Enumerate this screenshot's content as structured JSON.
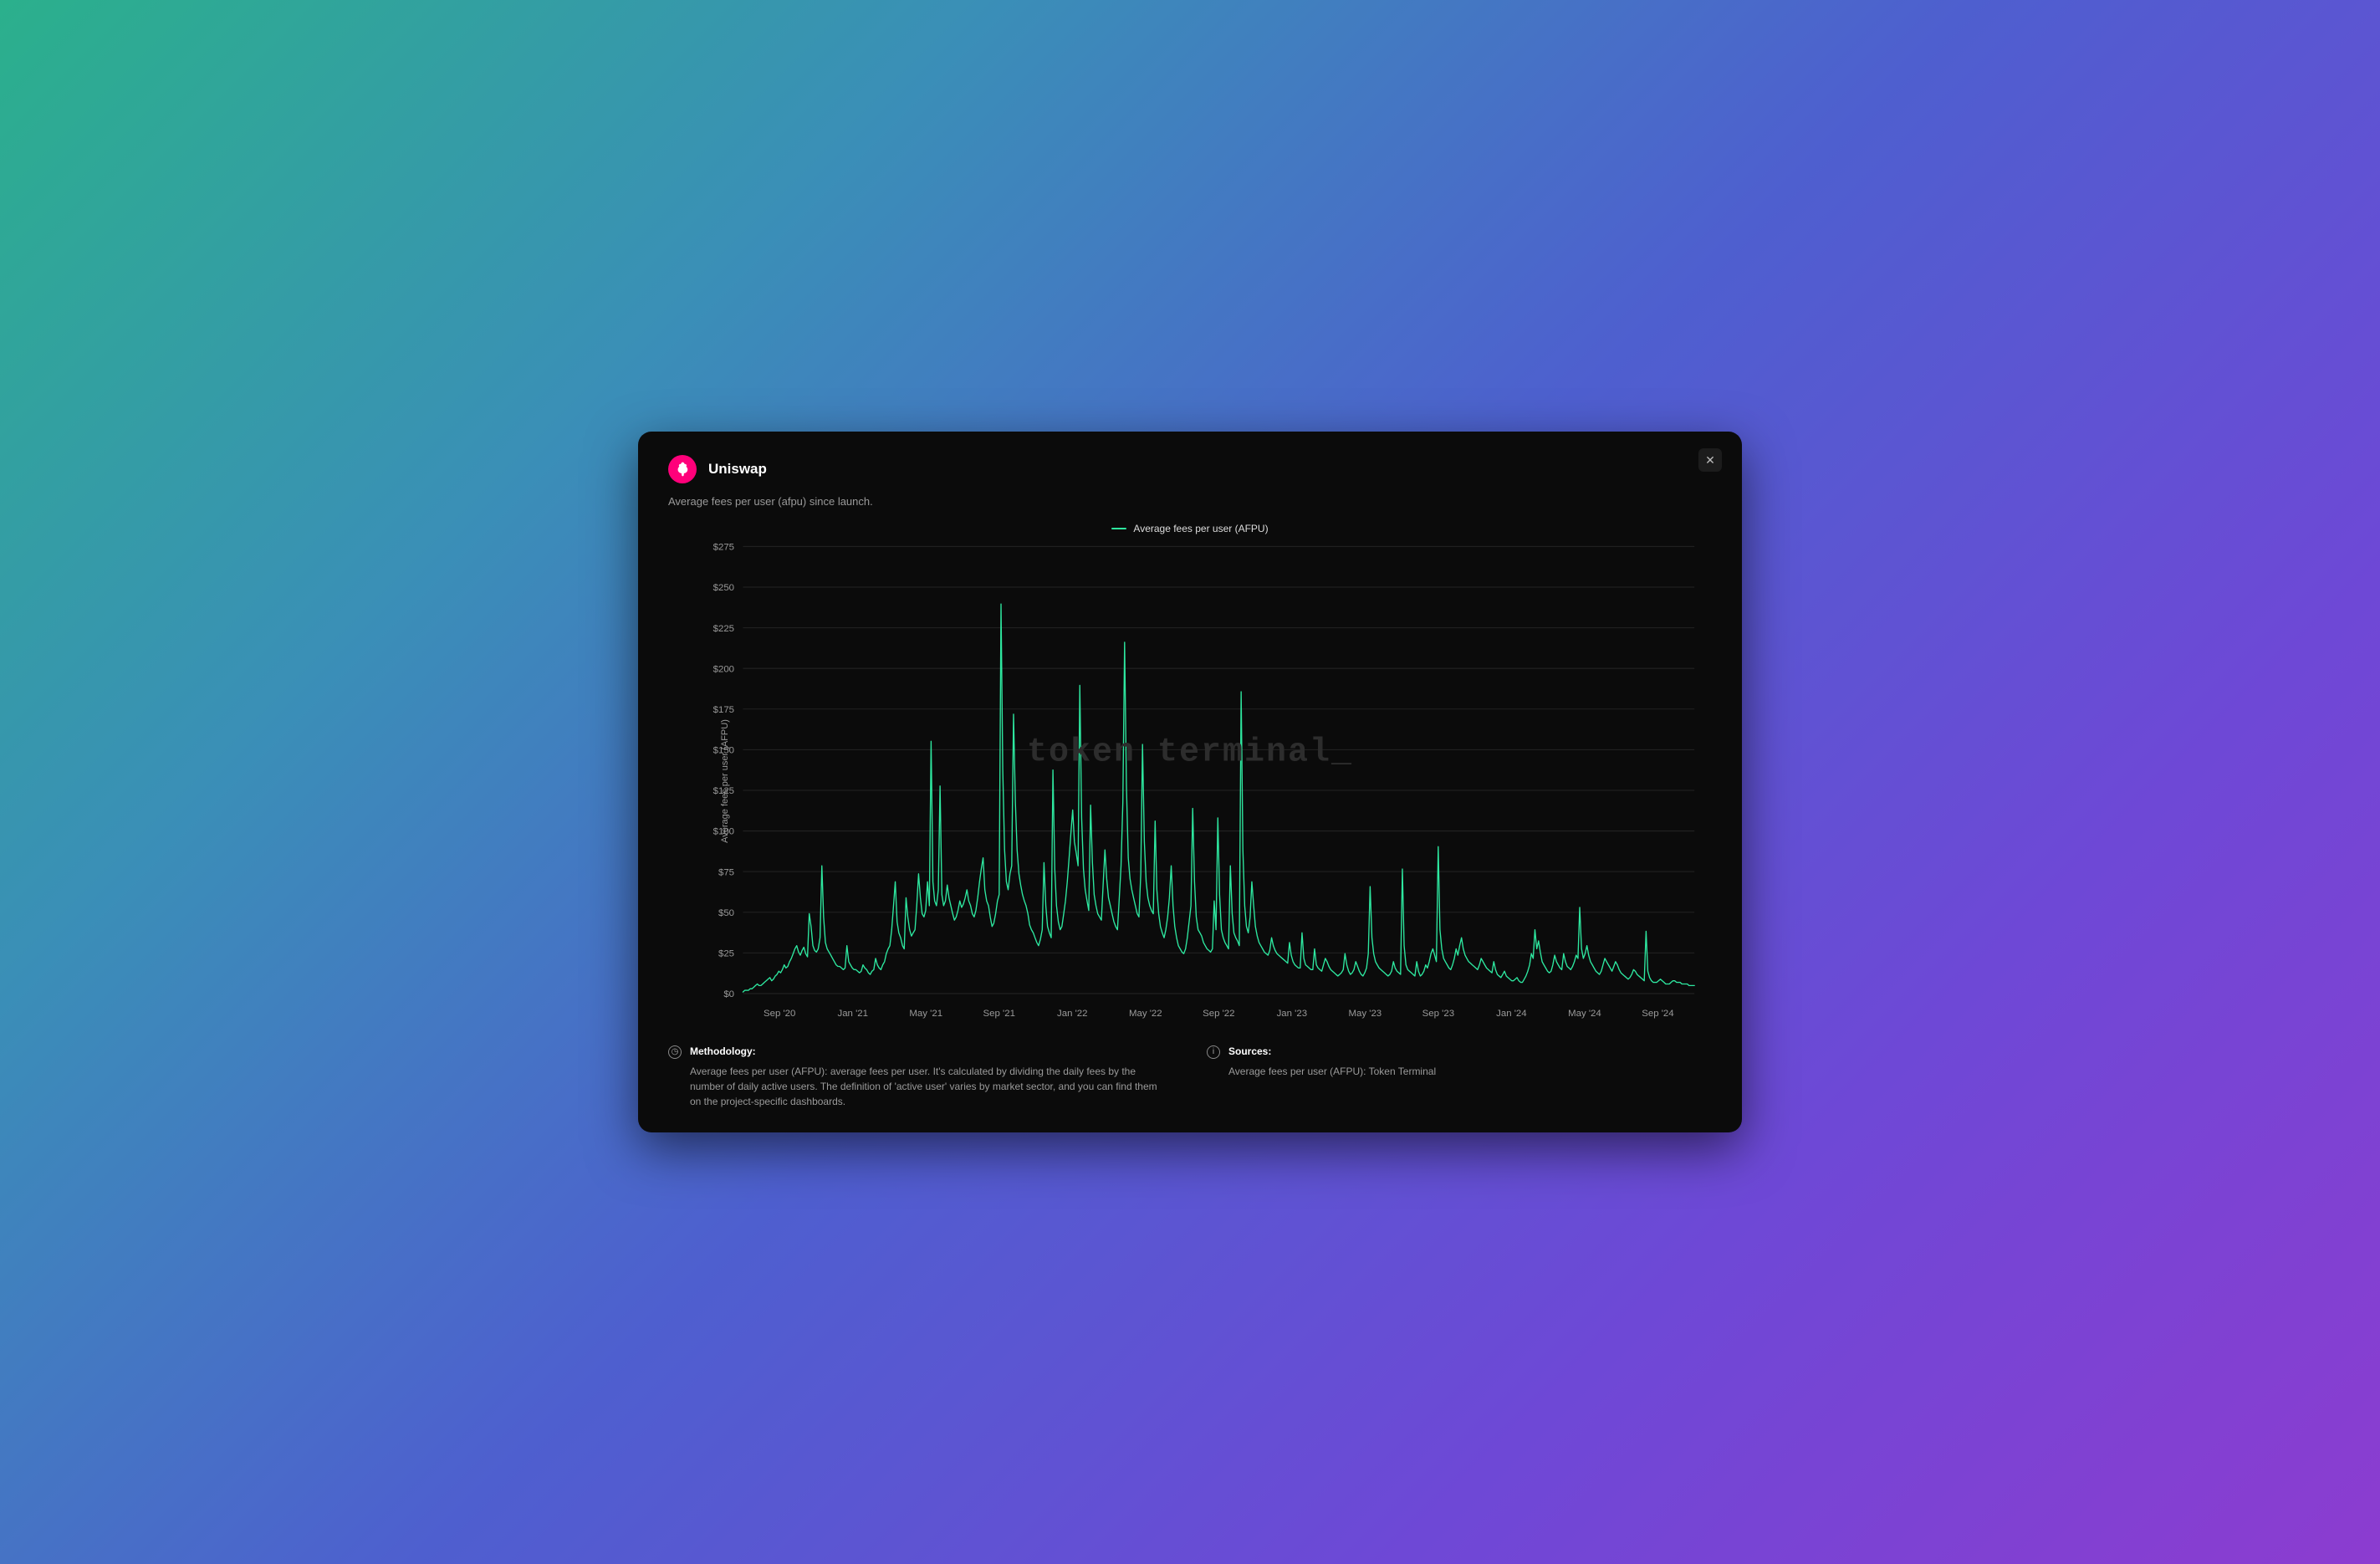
{
  "header": {
    "title": "Uniswap",
    "subtitle": "Average fees per user (afpu) since launch.",
    "logo_label": "Uniswap"
  },
  "close_label": "✕",
  "legend": {
    "series_name": "Average fees per user (AFPU)"
  },
  "y_axis_label": "Average fees per user (AFPU)",
  "watermark": "token terminal_",
  "footer": {
    "methodology_title": "Methodology:",
    "methodology_text": "Average fees per user (AFPU): average fees per user. It's calculated by dividing the daily fees by the number of daily active users. The definition of 'active user' varies by market sector, and you can find them on the project-specific dashboards.",
    "sources_title": "Sources:",
    "sources_text": "Average fees per user (AFPU): Token Terminal"
  },
  "colors": {
    "line": "#2ee8a0",
    "panel": "#0b0b0b",
    "grid": "#232323",
    "tick": "#9a9a9a"
  },
  "chart_data": {
    "type": "line",
    "title": "Average fees per user (afpu) since launch.",
    "xlabel": "",
    "ylabel": "Average fees per user (AFPU)",
    "ylim": [
      0,
      280
    ],
    "y_ticks": [
      "$0",
      "$25",
      "$50",
      "$75",
      "$100",
      "$125",
      "$150",
      "$175",
      "$200",
      "$225",
      "$250",
      "$275"
    ],
    "x_ticks": [
      "Sep '20",
      "Jan '21",
      "May '21",
      "Sep '21",
      "Jan '22",
      "May '22",
      "Sep '22",
      "Jan '23",
      "May '23",
      "Sep '23",
      "Jan '24",
      "May '24",
      "Sep '24"
    ],
    "series": [
      {
        "name": "Average fees per user (AFPU)",
        "values": [
          1,
          2,
          2,
          2,
          3,
          3,
          4,
          5,
          6,
          5,
          5,
          6,
          7,
          8,
          9,
          10,
          8,
          9,
          11,
          12,
          14,
          13,
          15,
          18,
          16,
          17,
          20,
          22,
          25,
          28,
          30,
          26,
          24,
          27,
          29,
          25,
          23,
          50,
          42,
          30,
          27,
          26,
          28,
          35,
          80,
          48,
          32,
          28,
          26,
          24,
          22,
          20,
          18,
          17,
          17,
          16,
          15,
          16,
          30,
          20,
          18,
          16,
          15,
          15,
          14,
          13,
          14,
          18,
          16,
          15,
          13,
          12,
          14,
          15,
          22,
          18,
          16,
          15,
          18,
          20,
          25,
          28,
          30,
          40,
          55,
          70,
          45,
          38,
          35,
          30,
          28,
          60,
          48,
          40,
          36,
          38,
          40,
          55,
          75,
          60,
          50,
          48,
          52,
          70,
          55,
          158,
          70,
          58,
          55,
          65,
          130,
          62,
          55,
          58,
          68,
          60,
          55,
          50,
          46,
          48,
          52,
          58,
          54,
          56,
          60,
          65,
          58,
          55,
          50,
          48,
          52,
          60,
          70,
          78,
          85,
          65,
          58,
          55,
          48,
          42,
          44,
          50,
          58,
          62,
          244,
          140,
          90,
          70,
          65,
          75,
          80,
          175,
          120,
          90,
          75,
          68,
          62,
          58,
          55,
          50,
          43,
          40,
          38,
          35,
          32,
          30,
          34,
          40,
          82,
          55,
          42,
          38,
          35,
          140,
          78,
          55,
          45,
          40,
          42,
          50,
          58,
          70,
          85,
          100,
          115,
          95,
          88,
          80,
          193,
          110,
          78,
          65,
          58,
          52,
          118,
          82,
          62,
          55,
          50,
          48,
          46,
          68,
          90,
          72,
          60,
          55,
          50,
          45,
          42,
          40,
          60,
          80,
          120,
          220,
          130,
          85,
          72,
          65,
          60,
          55,
          50,
          48,
          75,
          156,
          95,
          70,
          60,
          55,
          52,
          50,
          108,
          65,
          50,
          42,
          38,
          35,
          40,
          48,
          60,
          80,
          55,
          42,
          35,
          30,
          28,
          26,
          25,
          28,
          35,
          45,
          55,
          116,
          70,
          48,
          40,
          38,
          36,
          32,
          30,
          28,
          27,
          26,
          28,
          58,
          40,
          110,
          62,
          40,
          35,
          32,
          30,
          28,
          80,
          50,
          38,
          35,
          33,
          30,
          189,
          90,
          55,
          42,
          38,
          48,
          70,
          55,
          42,
          36,
          32,
          30,
          28,
          26,
          25,
          24,
          27,
          35,
          30,
          27,
          25,
          24,
          23,
          22,
          21,
          20,
          19,
          32,
          24,
          20,
          18,
          17,
          16,
          16,
          38,
          22,
          18,
          17,
          16,
          15,
          15,
          28,
          18,
          16,
          15,
          14,
          18,
          22,
          20,
          17,
          15,
          14,
          13,
          12,
          11,
          12,
          13,
          15,
          25,
          18,
          14,
          12,
          13,
          15,
          20,
          17,
          14,
          12,
          11,
          13,
          16,
          25,
          67,
          35,
          25,
          20,
          18,
          16,
          15,
          14,
          13,
          12,
          11,
          12,
          14,
          20,
          16,
          14,
          13,
          12,
          78,
          30,
          18,
          15,
          14,
          13,
          12,
          11,
          20,
          14,
          11,
          12,
          14,
          18,
          16,
          20,
          25,
          28,
          24,
          20,
          92,
          40,
          28,
          22,
          20,
          18,
          16,
          15,
          18,
          22,
          28,
          24,
          30,
          35,
          28,
          24,
          22,
          20,
          19,
          18,
          17,
          16,
          15,
          18,
          22,
          20,
          18,
          16,
          15,
          14,
          13,
          20,
          15,
          12,
          11,
          10,
          12,
          14,
          11,
          10,
          9,
          8,
          8,
          9,
          10,
          8,
          7,
          7,
          9,
          11,
          14,
          18,
          25,
          22,
          40,
          28,
          33,
          26,
          20,
          18,
          16,
          14,
          13,
          14,
          18,
          24,
          20,
          18,
          16,
          15,
          25,
          20,
          17,
          16,
          15,
          17,
          20,
          24,
          22,
          54,
          28,
          22,
          25,
          30,
          24,
          20,
          18,
          16,
          14,
          13,
          12,
          14,
          18,
          22,
          20,
          18,
          16,
          14,
          17,
          20,
          18,
          15,
          13,
          12,
          11,
          10,
          9,
          10,
          12,
          15,
          14,
          12,
          11,
          10,
          9,
          8,
          39,
          14,
          10,
          8,
          7,
          7,
          7,
          8,
          9,
          8,
          7,
          6,
          6,
          6,
          7,
          8,
          8,
          7,
          7,
          7,
          6,
          6,
          6,
          6,
          5,
          5,
          5,
          5
        ]
      }
    ]
  }
}
